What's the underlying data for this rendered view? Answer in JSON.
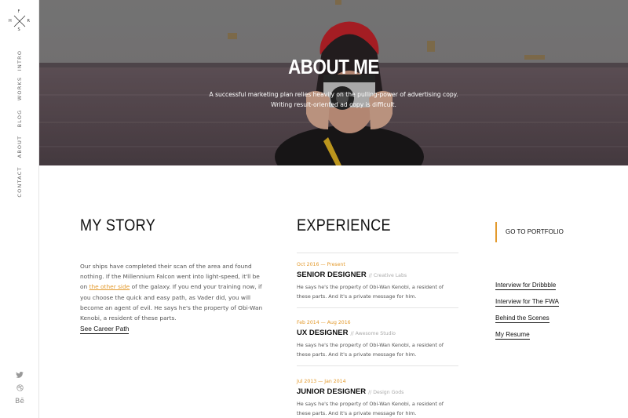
{
  "logo": {
    "letters": [
      "F",
      "R",
      "S",
      "H"
    ]
  },
  "sidebar": {
    "items": [
      {
        "label": "INTRO"
      },
      {
        "label": "WORKS"
      },
      {
        "label": "BLOG"
      },
      {
        "label": "ABOUT"
      },
      {
        "label": "CONTACT"
      }
    ],
    "social": [
      {
        "icon": "twitter-icon"
      },
      {
        "icon": "dribbble-icon"
      },
      {
        "icon": "behance-icon",
        "text": "Bē"
      }
    ]
  },
  "hero": {
    "title": "ABOUT ME",
    "subtitle": "A successful marketing plan relies heavily on the pulling-power of advertising copy. Writing result-oriented ad copy is difficult."
  },
  "story": {
    "heading": "MY STORY",
    "text_before": "Our ships have completed their scan of the area and found nothing. If the Millennium Falcon went into light-speed, it'll be on ",
    "link": "the other side",
    "text_after": " of the galaxy. If you end your training now, if you choose the quick and easy path, as Vader did, you will become an agent of evil. He says he's the property of Obi-Wan Kenobi, a resident of these parts.",
    "career_link": "See Career Path"
  },
  "experience": {
    "heading": "EXPERIENCE",
    "jobs": [
      {
        "date": "Oct 2016 — Present",
        "title": "SENIOR DESIGNER",
        "company": "// Creative Labs",
        "desc": "He says he's the property of Obi-Wan Kenobi, a resident of these parts. And it's a private message for him."
      },
      {
        "date": "Feb 2014 — Aug 2016",
        "title": "UX DESIGNER",
        "company": "// Awesome Studio",
        "desc": "He says he's the property of Obi-Wan Kenobi, a resident of these parts. And it's a private message for him."
      },
      {
        "date": "Jul 2013 — Jan 2014",
        "title": "JUNIOR DESIGNER",
        "company": "// Design Gods",
        "desc": "He says he's the property of Obi-Wan Kenobi, a resident of these parts. And it's a private message for him."
      }
    ]
  },
  "portfolio": {
    "label": "GO TO PORTFOLIO"
  },
  "links": [
    {
      "label": "Interview for Dribbble"
    },
    {
      "label": "Interview for The FWA"
    },
    {
      "label": "Behind the Scenes"
    },
    {
      "label": "My Resume"
    }
  ],
  "colors": {
    "accent": "#e39a2d"
  }
}
